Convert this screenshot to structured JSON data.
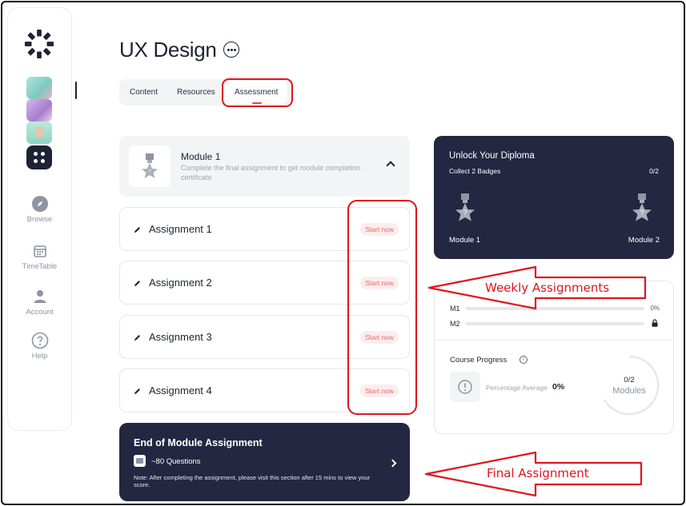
{
  "sidebar": {
    "nav": [
      {
        "label": "Browse",
        "icon": "compass-icon"
      },
      {
        "label": "TimeTable",
        "icon": "calendar-icon"
      },
      {
        "label": "Account",
        "icon": "user-icon"
      },
      {
        "label": "Help",
        "icon": "help-icon"
      }
    ]
  },
  "page": {
    "title": "UX Design",
    "tabs": [
      "Content",
      "Resources",
      "Assessment"
    ],
    "active_tab": "Assessment"
  },
  "module": {
    "title": "Module 1",
    "description": "Complete the final assignment to get module completion certificate"
  },
  "assignments": [
    {
      "name": "Assignment 1",
      "action": "Start now"
    },
    {
      "name": "Assignment 2",
      "action": "Start now"
    },
    {
      "name": "Assignment 3",
      "action": "Start now"
    },
    {
      "name": "Assignment 4",
      "action": "Start now"
    }
  ],
  "final": {
    "title": "End of Module Assignment",
    "questions": "~80 Questions",
    "note": "Note: After completing the assignment, please visit this section after 15 mins to view your score."
  },
  "diploma": {
    "title": "Unlock Your Diploma",
    "subtitle": "Collect 2 Badges",
    "count": "0/2",
    "badges": [
      "Module 1",
      "Module 2"
    ]
  },
  "progress": {
    "modules": [
      {
        "label": "M1",
        "value": "0%",
        "fraction": 0
      },
      {
        "label": "M2",
        "value": "",
        "locked": true,
        "fraction": 0
      }
    ],
    "course_progress_title": "Course Progress",
    "percentage_label": "Percentage Average",
    "percentage_value": "0%",
    "modules_count": "0/2",
    "modules_label": "Modules"
  },
  "annotations": {
    "weekly": "Weekly Assignments",
    "final": "Final Assignment"
  },
  "colors": {
    "navy": "#232741",
    "accent_red": "#e0141e",
    "start_text": "#e46a6a",
    "light_bg": "#f3f4f6"
  }
}
